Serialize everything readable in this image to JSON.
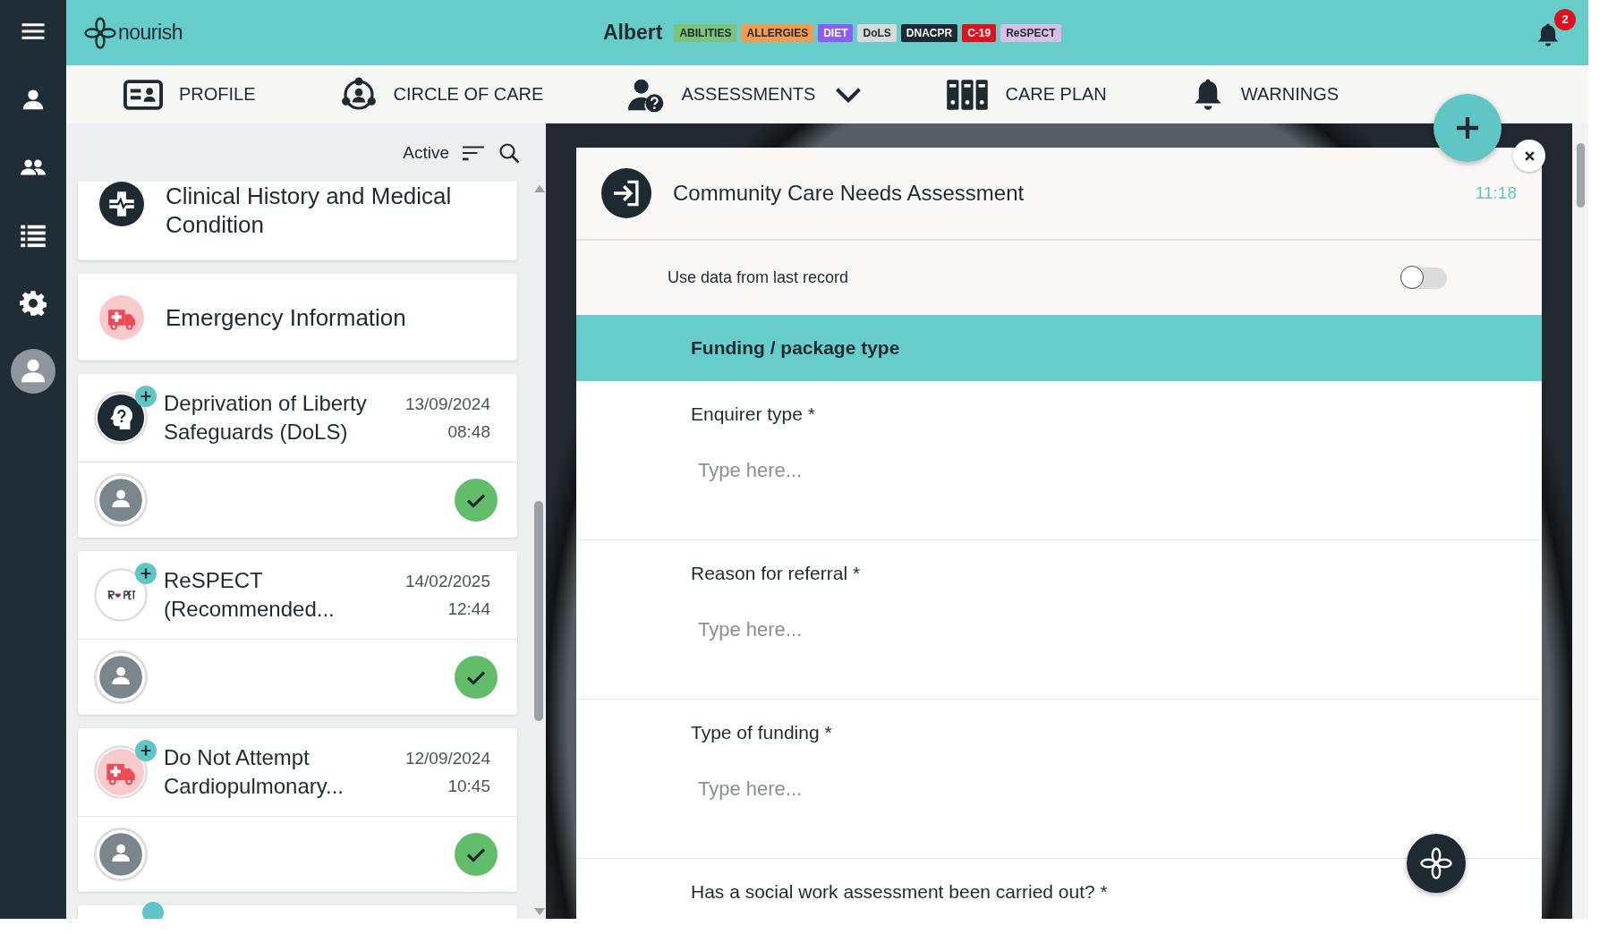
{
  "topbar": {
    "logo": "nourish",
    "resident_name": "Albert",
    "tags": [
      {
        "label": "ABILITIES",
        "color": "#7dc47a"
      },
      {
        "label": "ALLERGIES",
        "color": "#f59a4e"
      },
      {
        "label": "DIET",
        "color": "#8b5cf6"
      },
      {
        "label": "DoLS",
        "color": "#d9d9d9"
      },
      {
        "label": "DNACPR",
        "color": "#1d2a31"
      },
      {
        "label": "C-19",
        "color": "#e0101e"
      },
      {
        "label": "ReSPECT",
        "color": "#d9bfe6"
      }
    ],
    "notification_count": "2"
  },
  "nav": {
    "items": [
      {
        "label": "PROFILE",
        "dropdown": false
      },
      {
        "label": "CIRCLE OF CARE",
        "dropdown": false
      },
      {
        "label": "ASSESSMENTS",
        "dropdown": true
      },
      {
        "label": "CARE PLAN",
        "dropdown": false
      },
      {
        "label": "WARNINGS",
        "dropdown": false
      }
    ]
  },
  "list": {
    "filter_label": "Active",
    "records": [
      {
        "kind": "category",
        "title": "Clinical History and Medical Condition"
      },
      {
        "kind": "category",
        "title": "Emergency Information"
      },
      {
        "kind": "entry",
        "title": "Deprivation of Liberty Safeguards (DoLS)",
        "date": "13/09/2024",
        "time": "08:48",
        "completed": true
      },
      {
        "kind": "entry",
        "title": "ReSPECT (Recommended...",
        "date": "14/02/2025",
        "time": "12:44",
        "completed": true
      },
      {
        "kind": "entry",
        "title": "Do Not Attempt Cardiopulmonary...",
        "date": "12/09/2024",
        "time": "10:45",
        "completed": true
      },
      {
        "kind": "partial"
      }
    ]
  },
  "form": {
    "title": "Community Care Needs Assessment",
    "time": "11:18",
    "toggle": {
      "label": "Use data from last record",
      "on": false
    },
    "section": "Funding / package type",
    "fields": [
      {
        "label": "Enquirer type *",
        "placeholder": "Type here..."
      },
      {
        "label": "Reason for referral *",
        "placeholder": "Type here..."
      },
      {
        "label": "Type of funding *",
        "placeholder": "Type here..."
      },
      {
        "label": "Has a social work assessment been carried out? *"
      }
    ]
  }
}
